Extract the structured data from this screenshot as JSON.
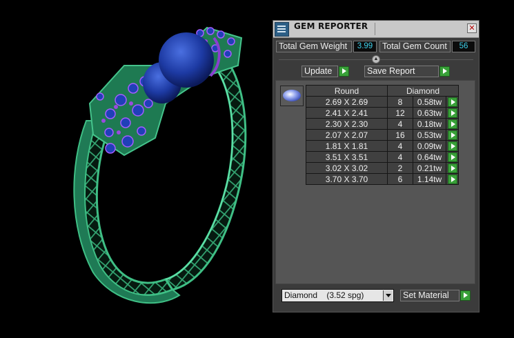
{
  "panel": {
    "title": "GEM REPORTER",
    "close_symbol": "✕",
    "total_gem_weight_label": "Total Gem Weight",
    "total_gem_weight_value": "3.99",
    "total_gem_count_label": "Total Gem Count",
    "total_gem_count_value": "56",
    "update_label": "Update",
    "save_report_label": "Save Report",
    "columns": {
      "shape": "Round",
      "material": "Diamond"
    },
    "rows": [
      {
        "size": "2.69 X 2.69",
        "count": "8",
        "weight": "0.58tw"
      },
      {
        "size": "2.41 X 2.41",
        "count": "12",
        "weight": "0.63tw"
      },
      {
        "size": "2.30 X 2.30",
        "count": "4",
        "weight": "0.18tw"
      },
      {
        "size": "2.07 X 2.07",
        "count": "16",
        "weight": "0.53tw"
      },
      {
        "size": "1.81 X 1.81",
        "count": "4",
        "weight": "0.09tw"
      },
      {
        "size": "3.51 X 3.51",
        "count": "4",
        "weight": "0.64tw"
      },
      {
        "size": "3.02 X 3.02",
        "count": "2",
        "weight": "0.21tw"
      },
      {
        "size": "3.70 X 3.70",
        "count": "6",
        "weight": "1.14tw"
      }
    ],
    "material_select_value": "Diamond    (3.52 spg)",
    "set_material_label": "Set Material"
  },
  "colors": {
    "value_text": "#3fd0ea",
    "play_green": "#38a038",
    "ring_green": "#2f9a6a",
    "gem_blue": "#1f3fa0",
    "gem_purple": "#8a3fd0"
  }
}
